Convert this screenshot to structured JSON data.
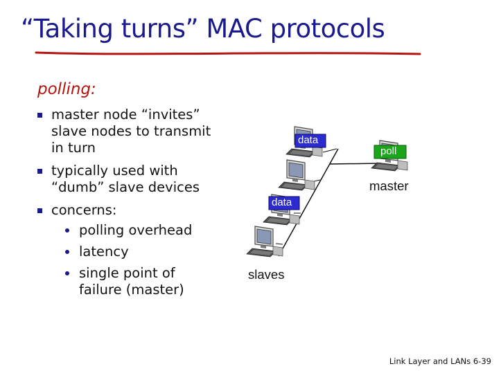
{
  "slide": {
    "title": "“Taking turns” MAC protocols",
    "subtitle": "polling:",
    "bullets": [
      {
        "text": "master node “invites” slave nodes to transmit in turn"
      },
      {
        "text": "typically used with “dumb” slave devices"
      },
      {
        "text": "concerns:"
      }
    ],
    "sub_bullets": [
      {
        "text": "polling overhead"
      },
      {
        "text": "latency"
      },
      {
        "text": "single point of failure (master)"
      }
    ],
    "footer": "Link Layer and LANs  6-39"
  },
  "diagram": {
    "slaves_label": "slaves",
    "master_label": "master",
    "data_tag_1": "data",
    "data_tag_2": "data",
    "poll_tag": "poll",
    "colors": {
      "data_tag": "#2b2bd0",
      "poll_tag": "#1aa51a",
      "link": "#111111"
    }
  },
  "colors": {
    "title": "#1a1a8c",
    "subtitle": "#b3140f",
    "underline": "#b3140f"
  }
}
